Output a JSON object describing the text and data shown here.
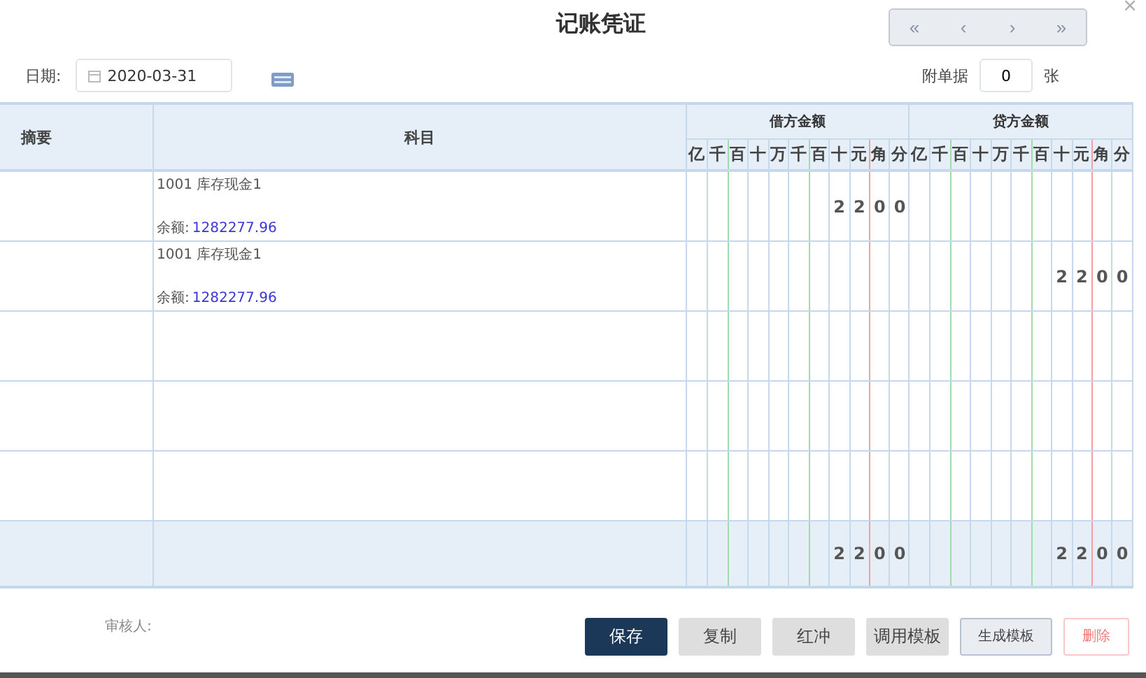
{
  "window": {
    "title": "记账凭证",
    "close": "×"
  },
  "pager": [
    "«",
    "‹",
    "›",
    "»"
  ],
  "date": {
    "label": "日期:",
    "value": "2020-03-31"
  },
  "attachments": {
    "label": "附单据",
    "value": "0",
    "unit": "张"
  },
  "table": {
    "columns": {
      "summary": "摘要",
      "account": "科目",
      "debit": "借方金额",
      "credit": "贷方金额",
      "debit_digits": [
        "亿",
        "千",
        "百",
        "十",
        "万",
        "千",
        "百",
        "十",
        "元",
        "角",
        "分"
      ],
      "credit_digits": [
        "亿",
        "千",
        "百",
        "十",
        "万",
        "千",
        "百",
        "十",
        "元",
        "角",
        "分"
      ]
    },
    "rows": [
      {
        "kind": "entry",
        "account": "1001 库存现金1",
        "balance_label": "余额:",
        "balance": "1282277.96",
        "debit": [
          "2",
          "2",
          "0",
          "0"
        ]
      },
      {
        "kind": "entry",
        "account": "1001 库存现金1",
        "balance_label": "余额:",
        "balance": "1282277.96",
        "credit": [
          "2",
          "2",
          "0",
          "0"
        ]
      },
      {
        "kind": "blank"
      },
      {
        "kind": "blank"
      },
      {
        "kind": "blank"
      }
    ],
    "total": {
      "debit": [
        "2",
        "2",
        "0",
        "0"
      ],
      "credit": [
        "2",
        "2",
        "0",
        "0"
      ]
    }
  },
  "reviewer": {
    "label": "审核人:"
  },
  "buttons": [
    {
      "label": "保存",
      "kind": "primary"
    },
    {
      "label": "复制",
      "kind": "plain"
    },
    {
      "label": "红冲",
      "kind": "plain"
    },
    {
      "label": "调用模板",
      "kind": "plain"
    },
    {
      "label": "生成模板",
      "kind": "outline"
    },
    {
      "label": "删除",
      "kind": "danger"
    }
  ]
}
